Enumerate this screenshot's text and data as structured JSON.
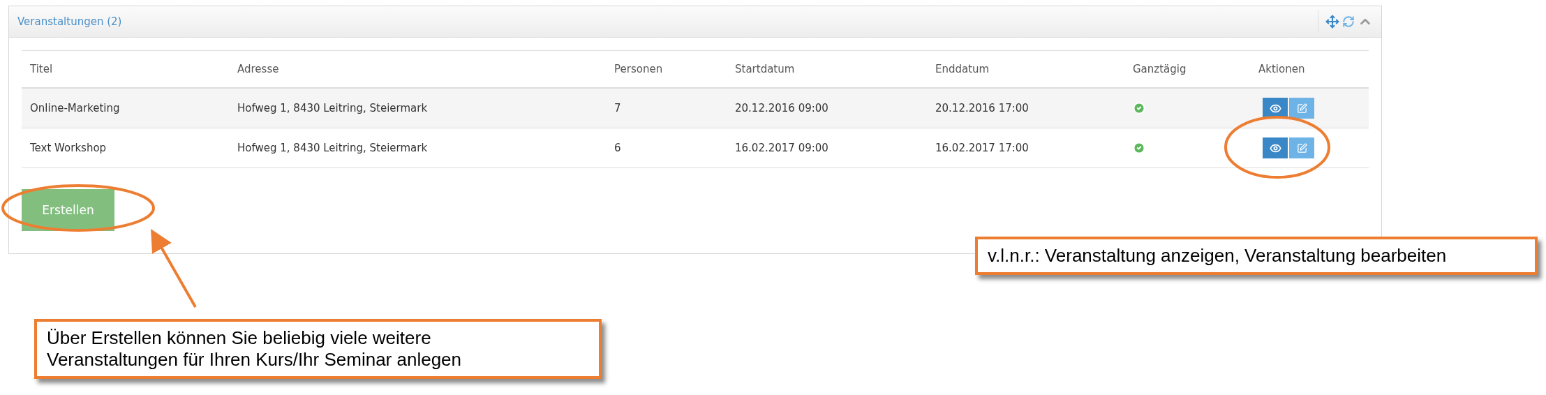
{
  "panel": {
    "title": "Veranstaltungen (2)",
    "table": {
      "columns": [
        "Titel",
        "Adresse",
        "Personen",
        "Startdatum",
        "Enddatum",
        "Ganztägig",
        "Aktionen"
      ],
      "rows": [
        {
          "title": "Online-Marketing",
          "address": "Hofweg 1, 8430 Leitring, Steiermark",
          "persons": "7",
          "start": "20.12.2016 09:00",
          "end": "20.12.2016 17:00",
          "all_day": true
        },
        {
          "title": "Text Workshop",
          "address": "Hofweg 1, 8430 Leitring, Steiermark",
          "persons": "6",
          "start": "16.02.2017 09:00",
          "end": "16.02.2017 17:00",
          "all_day": true
        }
      ]
    },
    "create_button": "Erstellen"
  },
  "callouts": [
    {
      "kind": "actions",
      "text": "v.l.n.r.: Veranstaltung anzeigen, Veranstaltung bearbeiten"
    },
    {
      "kind": "create",
      "text": "Über Erstellen können Sie beliebig viele weitere Veranstaltungen für Ihren Kurs/Ihr Seminar anlegen"
    }
  ]
}
